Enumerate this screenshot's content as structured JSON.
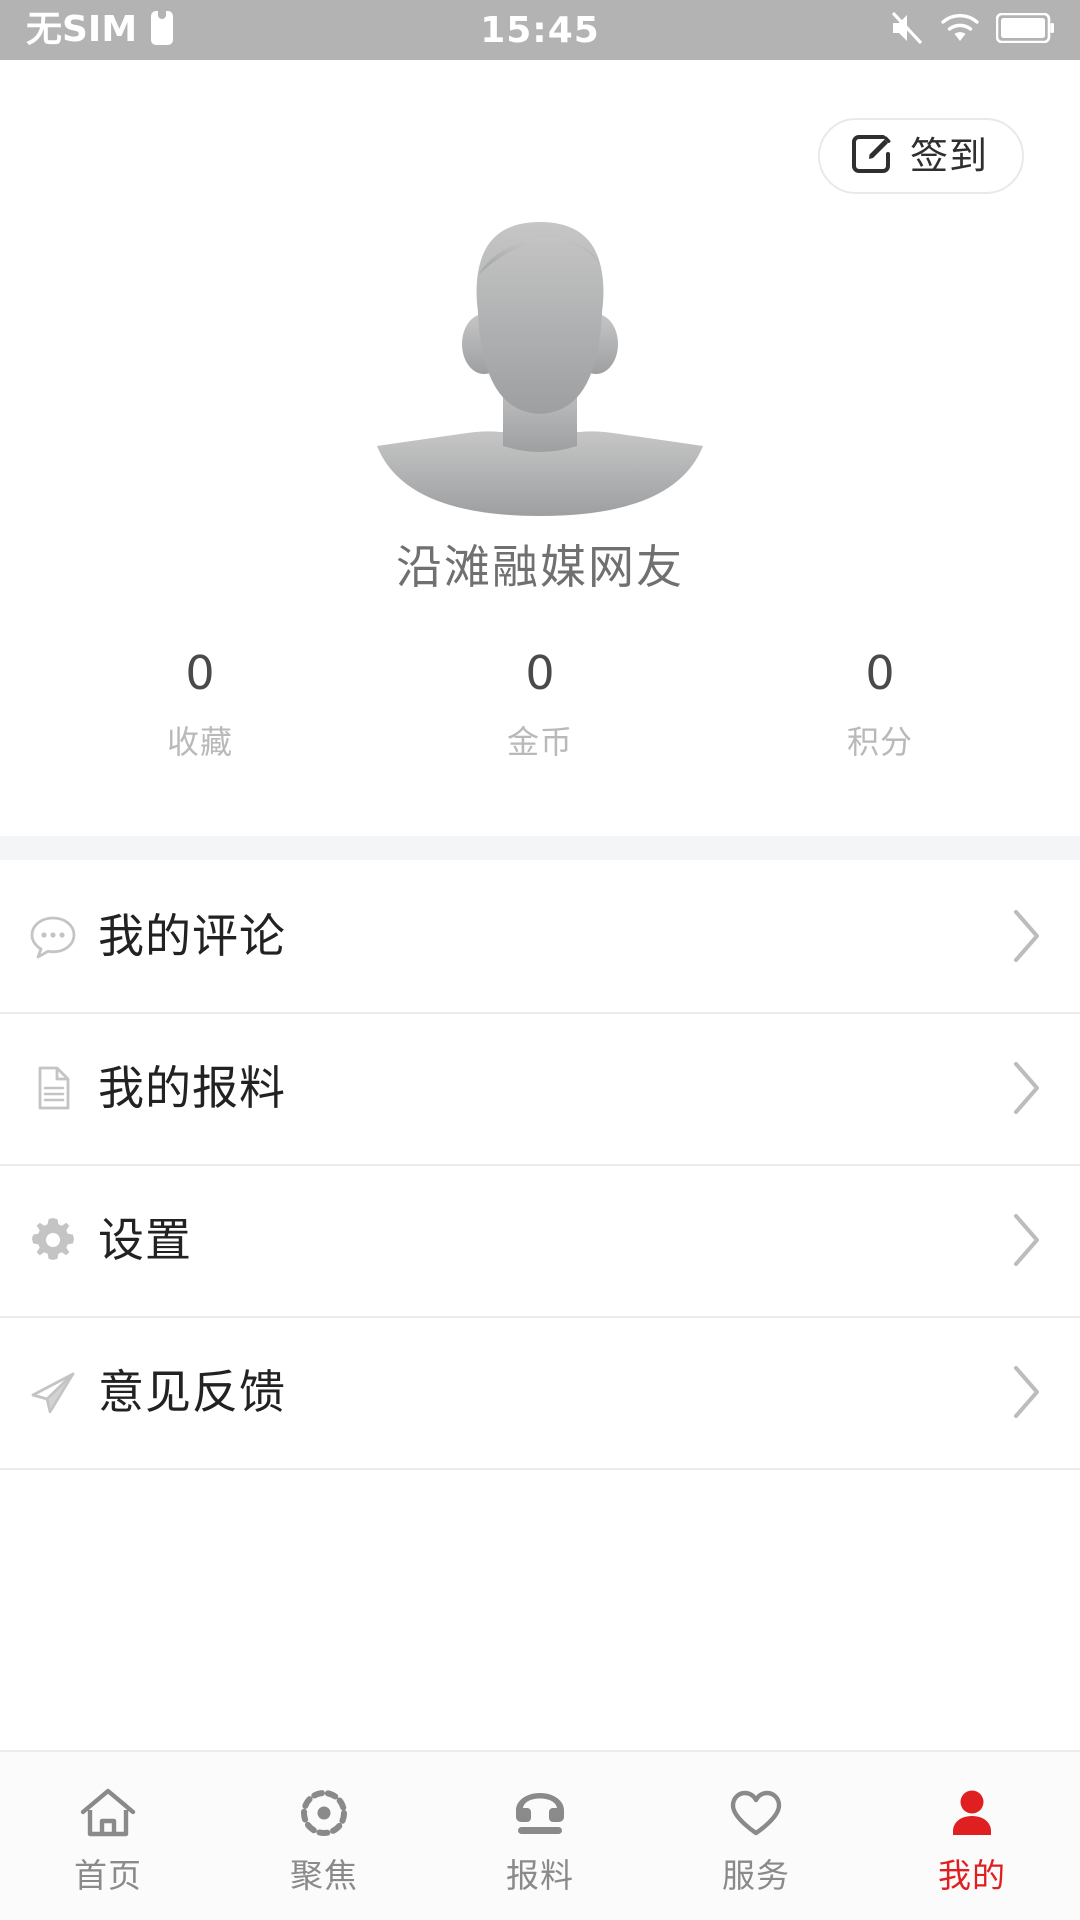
{
  "statusbar": {
    "carrier": "无SIM",
    "time": "15:45",
    "icons": {
      "sim": "sim-card-icon",
      "mute": "mute-icon",
      "wifi": "wifi-icon",
      "battery": "battery-icon"
    }
  },
  "profile": {
    "signin_label": "签到",
    "signin_icon": "edit-square-icon",
    "avatar_icon": "default-avatar-silhouette",
    "username": "沿滩融媒网友",
    "stats": [
      {
        "value": "0",
        "label": "收藏"
      },
      {
        "value": "0",
        "label": "金币"
      },
      {
        "value": "0",
        "label": "积分"
      }
    ]
  },
  "menu": {
    "items": [
      {
        "label": "我的评论",
        "icon": "comment-bubble-icon"
      },
      {
        "label": "我的报料",
        "icon": "document-icon"
      },
      {
        "label": "设置",
        "icon": "gear-icon"
      },
      {
        "label": "意见反馈",
        "icon": "paper-plane-icon"
      }
    ]
  },
  "tabbar": {
    "items": [
      {
        "label": "首页",
        "icon": "home-icon",
        "active": false
      },
      {
        "label": "聚焦",
        "icon": "focus-target-icon",
        "active": false
      },
      {
        "label": "报料",
        "icon": "telephone-icon",
        "active": false
      },
      {
        "label": "服务",
        "icon": "heart-icon",
        "active": false
      },
      {
        "label": "我的",
        "icon": "person-icon",
        "active": true
      }
    ]
  },
  "colors": {
    "statusbar_bg": "#b3b3b3",
    "accent_red": "#e02020",
    "inactive_gray": "#8a8a8a",
    "divider": "#ececec",
    "band": "#f4f5f7",
    "username_gray": "#707070",
    "caption_gray": "#b9b9b9"
  }
}
